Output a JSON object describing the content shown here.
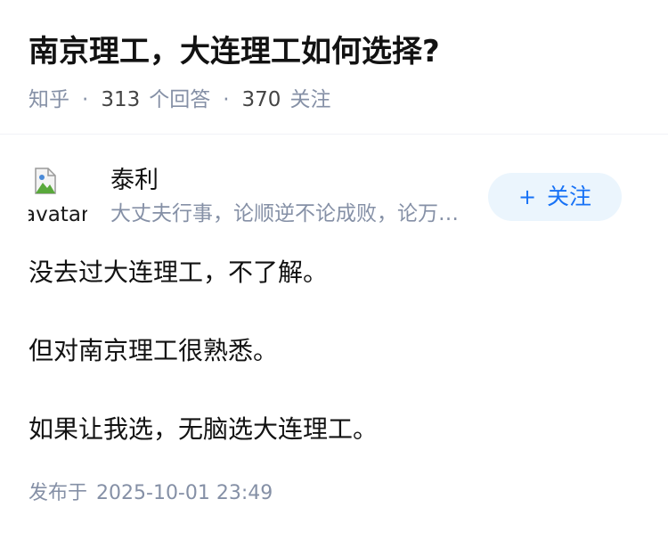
{
  "question": {
    "title": "南京理工，大连理工如何选择?",
    "site": "知乎",
    "answers_count": "313",
    "answers_label": "个回答",
    "followers_count": "370",
    "followers_label": "关注"
  },
  "author": {
    "avatar_alt": "avatar",
    "name": "泰利",
    "bio": "大丈夫行事，论顺逆不论成败，论万世不论一生。",
    "follow_label": "关注",
    "follow_icon": "plus-icon"
  },
  "answer": {
    "paragraphs": [
      "没去过大连理工，不了解。",
      "但对南京理工很熟悉。",
      "如果让我选，无脑选大连理工。"
    ],
    "published_label": "发布于",
    "published_time": "2025-10-01 23:49"
  },
  "colors": {
    "accent": "#1772f6",
    "follow_bg": "#ebf5fd",
    "meta_gray": "#8590a6"
  }
}
